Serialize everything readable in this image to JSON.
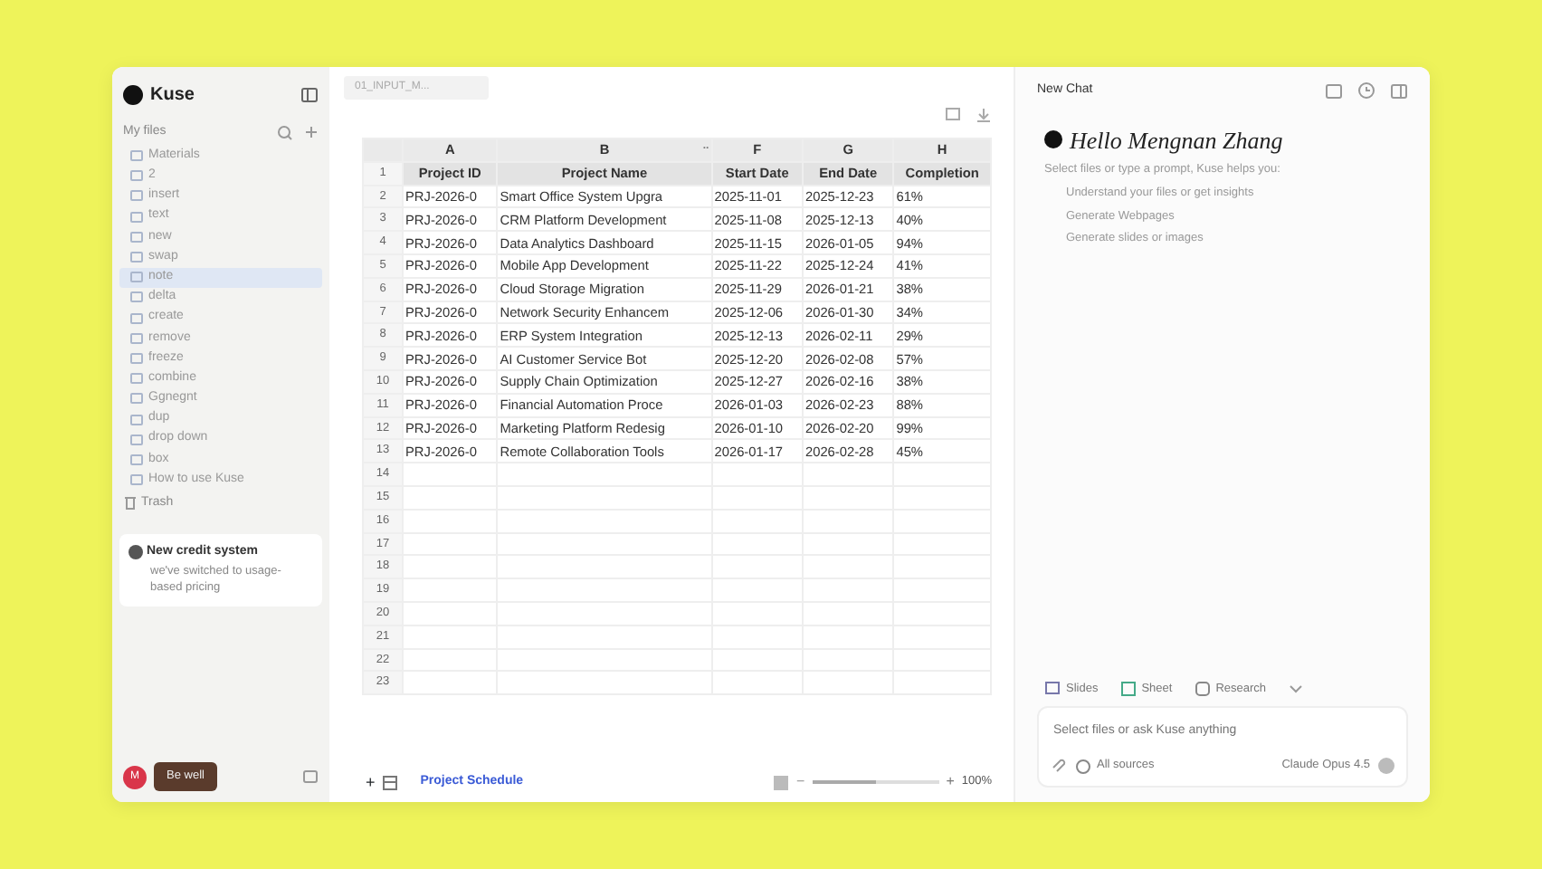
{
  "sidebar": {
    "brand": "Kuse",
    "section": "My files",
    "items": [
      {
        "label": "Materials",
        "selected": false
      },
      {
        "label": "2",
        "selected": false
      },
      {
        "label": "insert",
        "selected": false
      },
      {
        "label": "text",
        "selected": false
      },
      {
        "label": "new",
        "selected": false
      },
      {
        "label": "swap",
        "selected": false
      },
      {
        "label": "note",
        "selected": true
      },
      {
        "label": "delta",
        "selected": false
      },
      {
        "label": "create",
        "selected": false
      },
      {
        "label": "remove",
        "selected": false
      },
      {
        "label": "freeze",
        "selected": false
      },
      {
        "label": "combine",
        "selected": false
      },
      {
        "label": "Ggnegnt",
        "selected": false
      },
      {
        "label": "dup",
        "selected": false
      },
      {
        "label": "drop down",
        "selected": false
      },
      {
        "label": "box",
        "selected": false
      },
      {
        "label": "How to use Kuse",
        "selected": false
      }
    ],
    "trash": "Trash",
    "notice": {
      "title": "New credit system",
      "text": "we've switched to usage-based pricing"
    },
    "avatar": "M",
    "user_button": "Be well"
  },
  "editor": {
    "tab": "01_INPUT_M...",
    "sheet": {
      "columns": [
        "A",
        "B",
        "F",
        "G",
        "H"
      ],
      "hidden_marker": "..",
      "header": [
        "Project ID",
        "Project Name",
        "Start Date",
        "End Date",
        "Completion"
      ],
      "rows": [
        [
          "PRJ-2026-0",
          "Smart Office System Upgra",
          "2025-11-01",
          "2025-12-23",
          "61%"
        ],
        [
          "PRJ-2026-0",
          "CRM Platform Development",
          "2025-11-08",
          "2025-12-13",
          "40%"
        ],
        [
          "PRJ-2026-0",
          "Data Analytics Dashboard",
          "2025-11-15",
          "2026-01-05",
          "94%"
        ],
        [
          "PRJ-2026-0",
          "Mobile App Development",
          "2025-11-22",
          "2025-12-24",
          "41%"
        ],
        [
          "PRJ-2026-0",
          "Cloud Storage Migration",
          "2025-11-29",
          "2026-01-21",
          "38%"
        ],
        [
          "PRJ-2026-0",
          "Network Security Enhancem",
          "2025-12-06",
          "2026-01-30",
          "34%"
        ],
        [
          "PRJ-2026-0",
          "ERP System Integration",
          "2025-12-13",
          "2026-02-11",
          "29%"
        ],
        [
          "PRJ-2026-0",
          "AI Customer Service Bot",
          "2025-12-20",
          "2026-02-08",
          "57%"
        ],
        [
          "PRJ-2026-0",
          "Supply Chain Optimization",
          "2025-12-27",
          "2026-02-16",
          "38%"
        ],
        [
          "PRJ-2026-0",
          "Financial Automation Proce",
          "2026-01-03",
          "2026-02-23",
          "88%"
        ],
        [
          "PRJ-2026-0",
          "Marketing Platform Redesig",
          "2026-01-10",
          "2026-02-20",
          "99%"
        ],
        [
          "PRJ-2026-0",
          "Remote Collaboration Tools",
          "2026-01-17",
          "2026-02-28",
          "45%"
        ]
      ],
      "row_numbers": [
        "1",
        "2",
        "3",
        "4",
        "5",
        "6",
        "7",
        "8",
        "9",
        "10",
        "11",
        "12",
        "13",
        "14",
        "15",
        "16",
        "17",
        "18",
        "19",
        "20",
        "21",
        "22",
        "23"
      ]
    },
    "sheet_tab": "Project Schedule",
    "add": "+",
    "zoom": {
      "minus": "−",
      "plus": "+",
      "level": 0.5,
      "reading": "100%"
    }
  },
  "chat": {
    "title": "New Chat",
    "greeting": "Hello Mengnan Zhang",
    "intro": "Select files or type a prompt, Kuse helps you:",
    "bullets": [
      "Understand your files or get insights",
      "Generate Webpages",
      "Generate slides or images"
    ],
    "chips": [
      "Slides",
      "Sheet",
      "Research"
    ],
    "placeholder": "Select files or ask Kuse anything",
    "sources": "All sources",
    "model": "Claude Opus 4.5"
  }
}
